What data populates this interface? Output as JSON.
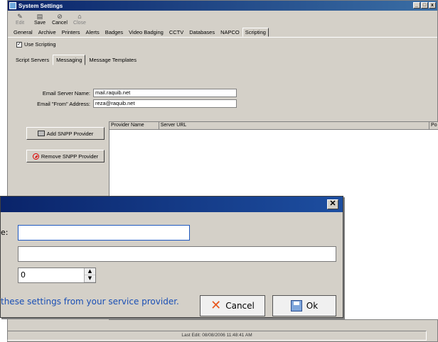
{
  "window": {
    "title": "System Settings",
    "controls": [
      "_",
      "□",
      "x"
    ]
  },
  "toolbar": {
    "edit": {
      "label": "Edit",
      "icon": "edit-icon"
    },
    "save": {
      "label": "Save",
      "icon": "save-icon"
    },
    "cancel": {
      "label": "Cancel",
      "icon": "cancel-icon"
    },
    "close": {
      "label": "Close",
      "icon": "close-icon"
    }
  },
  "tabs": [
    "General",
    "Archive",
    "Printers",
    "Alerts",
    "Badges",
    "Video Badging",
    "CCTV",
    "Databases",
    "NAPCO",
    "Scripting"
  ],
  "active_tab": "Scripting",
  "use_scripting": {
    "label": "Use Scripting",
    "checked": true
  },
  "sub_tabs": [
    "Script Servers",
    "Messaging",
    "Message Templates"
  ],
  "active_sub_tab": "Messaging",
  "email": {
    "server_label": "Email Server Name:",
    "server_value": "mail.raquib.net",
    "from_label": "Email \"From\" Address:",
    "from_value": "reza@raquib.net"
  },
  "buttons": {
    "add_snpp": "Add SNPP Provider",
    "remove_snpp": "Remove SNPP Provider"
  },
  "table": {
    "columns": [
      "Provider Name",
      "Server URL",
      "Po"
    ]
  },
  "dialog": {
    "name_label": "e:",
    "name_value": "",
    "url_value": "",
    "port_value": "0",
    "hint": "these settings from your service provider.",
    "cancel_label": "Cancel",
    "ok_label": "Ok"
  },
  "status": {
    "last_edit": "Last Edit: 08/08/2006 11:48:41 AM"
  }
}
